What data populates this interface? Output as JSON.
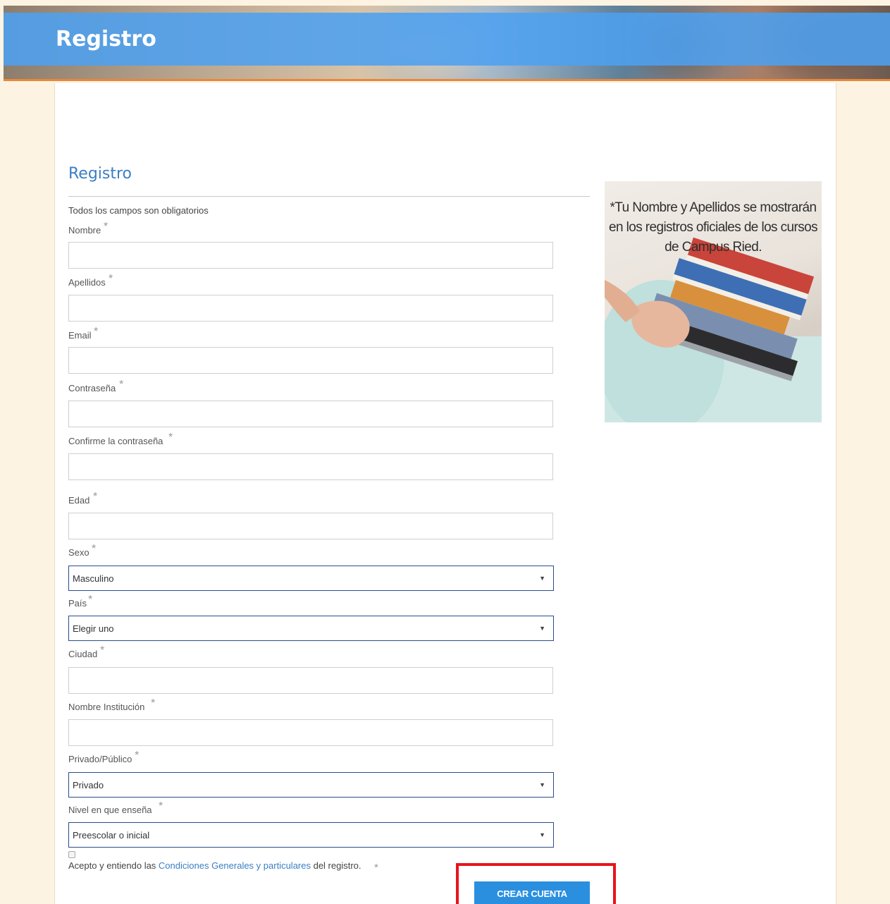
{
  "header": {
    "title": "Registro"
  },
  "form": {
    "title": "Registro",
    "note": "Todos los campos son obligatorios",
    "required_marker": "*",
    "fields": {
      "nombre": {
        "label": "Nombre",
        "value": ""
      },
      "apellidos": {
        "label": "Apellidos",
        "value": ""
      },
      "email": {
        "label": "Email",
        "value": ""
      },
      "contrasena": {
        "label": "Contraseña",
        "value": ""
      },
      "confirme": {
        "label": "Confirme la contraseña",
        "value": ""
      },
      "edad": {
        "label": "Edad",
        "value": ""
      },
      "sexo": {
        "label": "Sexo",
        "selected": "Masculino"
      },
      "pais": {
        "label": "País",
        "selected": "Elegir uno"
      },
      "ciudad": {
        "label": "Ciudad",
        "value": ""
      },
      "institucion": {
        "label": "Nombre Institución",
        "value": ""
      },
      "privado": {
        "label": "Privado/Público",
        "selected": "Privado"
      },
      "nivel": {
        "label": "Nivel en que enseña",
        "selected": "Preescolar o inicial"
      }
    },
    "terms": {
      "prefix": "Acepto y entiendo las ",
      "link": "Condiciones Generales y particulares",
      "suffix": " del registro.",
      "checked": false
    },
    "submit_label": "CREAR CUENTA"
  },
  "side_image": {
    "caption": "*Tu Nombre y Apellidos se mostrarán en los registros oficiales de los cursos de Campus Ried."
  },
  "colors": {
    "accent_blue": "#3b7fc4",
    "button_blue": "#2b8fe0",
    "banner_bar": "#4da0f0",
    "highlight_red": "#e8141b",
    "page_bg": "#fdf3e3"
  }
}
